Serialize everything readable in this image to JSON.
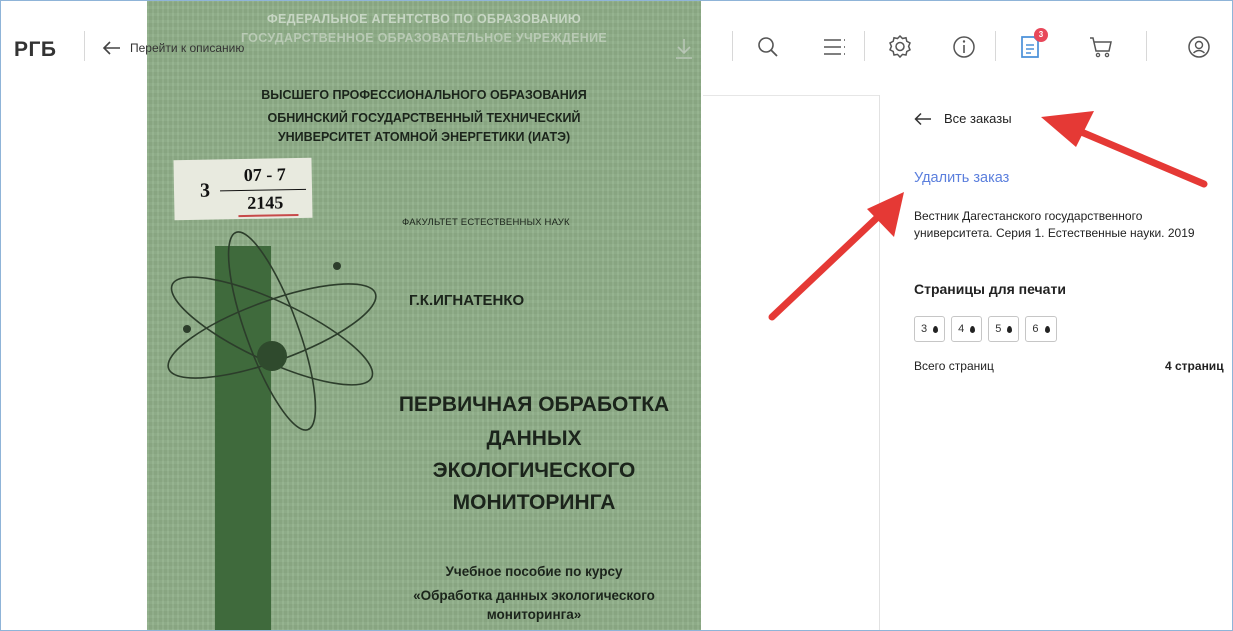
{
  "app": {
    "logo": "РГБ"
  },
  "toolbar": {
    "back_label": "Перейти к описанию",
    "cart_badge": "3",
    "icons": [
      "arrow-left-icon",
      "download-icon",
      "search-icon",
      "list-icon",
      "settings-gear-icon",
      "info-icon",
      "orders-document-icon",
      "cart-icon",
      "user-account-icon"
    ]
  },
  "book": {
    "header_line1": "ФЕДЕРАЛЬНОЕ АГЕНТСТВО ПО ОБРАЗОВАНИЮ",
    "header_line2": "ГОСУДАРСТВЕННОЕ ОБРАЗОВАТЕЛЬНОЕ УЧРЕЖДЕНИЕ",
    "header_line3": "ВЫСШЕГО ПРОФЕССИОНАЛЬНОГО ОБРАЗОВАНИЯ",
    "header_line4": "ОБНИНСКИЙ ГОСУДАРСТВЕННЫЙ ТЕХНИЧЕСКИЙ",
    "header_line5": "УНИВЕРСИТЕТ АТОМНОЙ ЭНЕРГЕТИКИ (ИАТЭ)",
    "label_number": "3",
    "label_top": "07 - 7",
    "label_bottom": "2145",
    "faculty": "ФАКУЛЬТЕТ ЕСТЕСТВЕННЫХ НАУК",
    "author": "Г.К.ИГНАТЕНКО",
    "title_line1": "ПЕРВИЧНАЯ ОБРАБОТКА",
    "title_line2": "ДАННЫХ",
    "title_line3": "ЭКОЛОГИЧЕСКОГО",
    "title_line4": "МОНИТОРИНГА",
    "subtitle_line1": "Учебное пособие по курсу",
    "subtitle_line2": "«Обработка данных экологического",
    "subtitle_line3": "мониторинга»"
  },
  "panel": {
    "all_orders": "Все заказы",
    "delete_order": "Удалить заказ",
    "journal": "Вестник Дагестанского государственного университета. Серия 1. Естественные науки. 2019",
    "pages_heading": "Страницы для печати",
    "pages": [
      {
        "label": "3"
      },
      {
        "label": "4"
      },
      {
        "label": "5"
      },
      {
        "label": "6"
      }
    ],
    "total_label": "Всего страниц",
    "total_value": "4 страниц"
  },
  "colors": {
    "link": "#5b7fdd",
    "badge": "#e8485a",
    "annotation_arrow": "#e53935",
    "book_cover": "#8fae88"
  }
}
